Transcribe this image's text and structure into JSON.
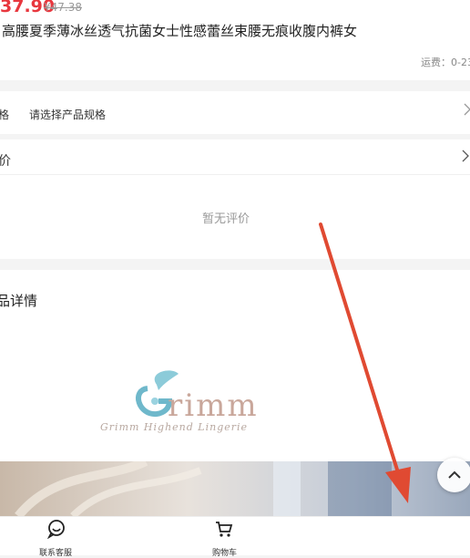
{
  "price": {
    "current": "37.90",
    "original": "¥47.38"
  },
  "product": {
    "title": "高腰夏季薄冰丝透气抗菌女士性感蕾丝束腰无痕收腹内裤女",
    "shipping": "运费：0-23"
  },
  "spec": {
    "label": "格",
    "value": "请选择产品规格"
  },
  "review": {
    "label": "价",
    "empty_text": "暂无评价"
  },
  "detail": {
    "title": "品详情"
  },
  "logo": {
    "brand": "Grimm",
    "tagline": "Grimm Highend Lingerie"
  },
  "bottom_bar": {
    "customer_service": "联系客服",
    "cart": "购物车"
  },
  "colors": {
    "price": "#e8373e",
    "annotation": "#e04a32"
  },
  "icons": {
    "customer_service": "chat-bubble-icon",
    "cart": "cart-icon",
    "scroll_top": "arrow-up-icon"
  }
}
